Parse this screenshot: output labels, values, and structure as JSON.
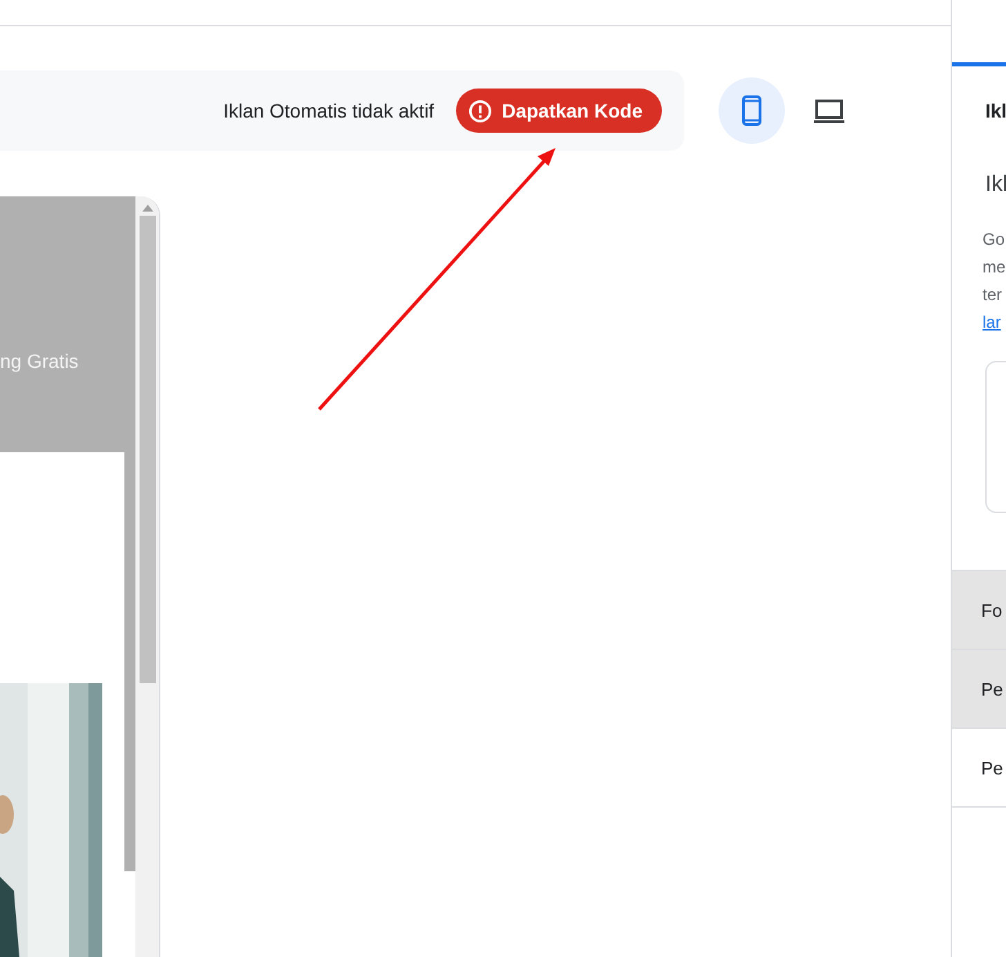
{
  "toolbar": {
    "status": "Iklan Otomatis tidak aktif",
    "action": {
      "label": "Dapatkan Kode",
      "kind": "error"
    }
  },
  "devices": [
    {
      "kind": "phone",
      "selected": true
    },
    {
      "kind": "laptop",
      "selected": false
    }
  ],
  "preview": {
    "banner_text": "ng Gratis"
  },
  "side_panel": {
    "tab_active": true,
    "heading": "Ikl",
    "subheading": "Ikl",
    "paragraph": [
      "Go",
      "me",
      "ter"
    ],
    "link": "lar",
    "rows": [
      {
        "label": "Fo",
        "highlighted": true
      },
      {
        "label": "Pe",
        "highlighted": true
      },
      {
        "label": "Pe",
        "highlighted": false
      }
    ]
  }
}
